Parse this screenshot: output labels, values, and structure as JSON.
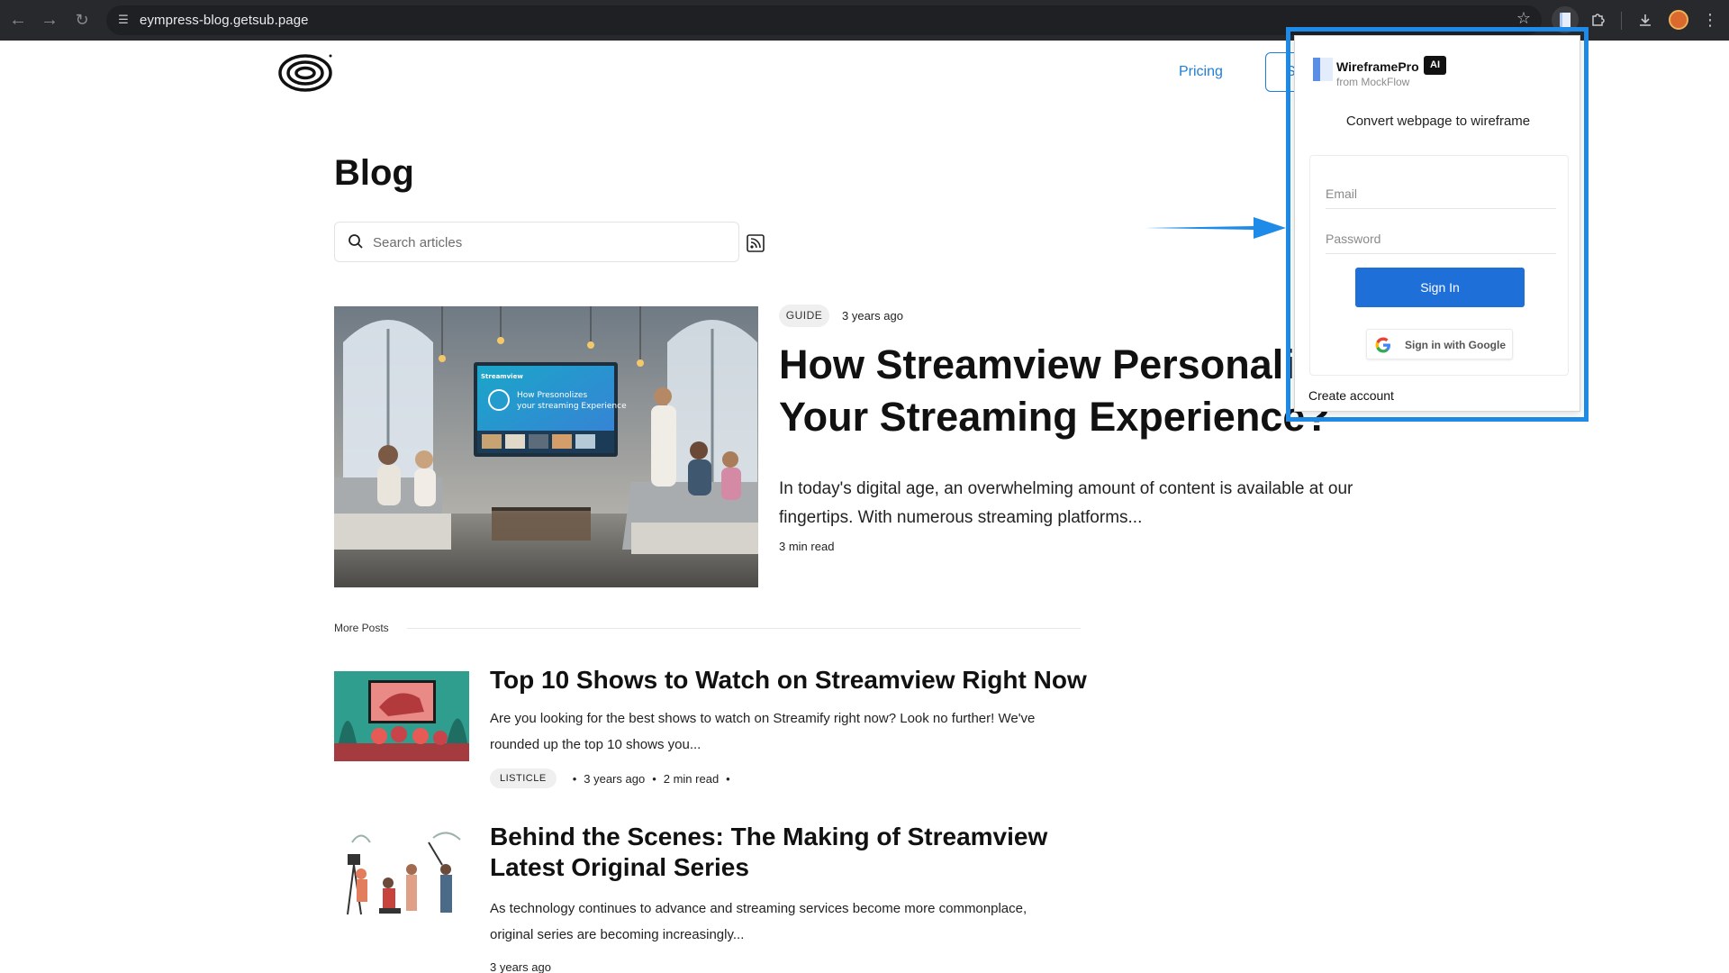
{
  "browser": {
    "url": "eympress-blog.getsub.page",
    "icons": [
      "back-icon",
      "forward-icon",
      "reload-icon",
      "site-settings-icon",
      "bookmark-star-icon",
      "wireframepro-extension-icon",
      "extensions-puzzle-icon",
      "downloads-icon",
      "profile-avatar",
      "more-menu-icon"
    ]
  },
  "site_header": {
    "pricing_label": "Pricing",
    "button_label": "S"
  },
  "blog": {
    "title": "Blog",
    "search_placeholder": "Search articles",
    "featured": {
      "tag": "GUIDE",
      "date": "3 years ago",
      "title_line1": "How Streamview Personalize",
      "title_line2": "Your Streaming Experience?",
      "excerpt": "In today's digital age, an overwhelming amount of content is available at our fingertips. With numerous streaming platforms...",
      "read_time": "3 min read",
      "image": {
        "brand": "Streamview",
        "headline_line1": "How Presonolizes",
        "headline_line2": "your streaming Experience"
      }
    },
    "more_posts_label": "More Posts",
    "posts": [
      {
        "title": "Top 10 Shows to Watch on Streamview Right Now",
        "excerpt": "Are you looking for the best shows to watch on Streamify right now? Look no further! We've rounded up the top 10 shows you...",
        "tag": "LISTICLE",
        "date": "3 years ago",
        "read_time": "2 min read"
      },
      {
        "title_line1": "Behind the Scenes: The Making of Streamview",
        "title_line2": "Latest Original Series",
        "excerpt": "As technology continues to advance and streaming services become more commonplace, original series are becoming increasingly...",
        "date": "3 years ago"
      }
    ]
  },
  "popup": {
    "brand_name": "WireframePro",
    "badge": "AI",
    "brand_sub": "from MockFlow",
    "heading": "Convert webpage to wireframe",
    "email_placeholder": "Email",
    "password_placeholder": "Password",
    "signin_label": "Sign In",
    "google_label": "Sign in with Google",
    "create_account_label": "Create account"
  },
  "colors": {
    "accent": "#1f7ed8",
    "highlight": "#1e8be8",
    "signin_button": "#1f6fd8",
    "chrome_bg": "#28292c"
  }
}
